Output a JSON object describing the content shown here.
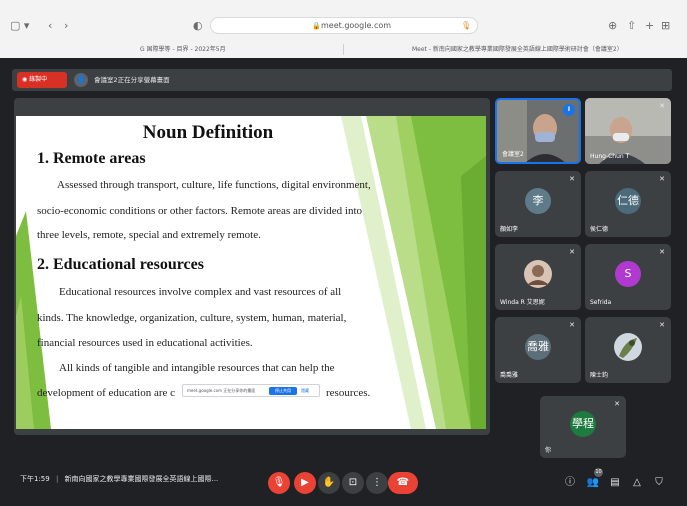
{
  "browser": {
    "url": "meet.google.com",
    "tabs": [
      "G 国際學等 - 目界 - 2022年5月",
      "Meet - 新南向國家之教學專業國際發展全英語線上國際學術研討會（會議室2）"
    ]
  },
  "banner": {
    "recording_label": "錄製中",
    "presenting_label": "會議室2正在分享螢幕畫面"
  },
  "slide": {
    "title": "Noun Definition",
    "section1_heading": "1. Remote areas",
    "section1_lines": [
      "Assessed through transport, culture, life functions, digital environment,",
      "socio-economic conditions or other factors. Remote areas are divided into",
      "three levels, remote, special and extremely remote."
    ],
    "section2_heading": "2. Educational resources",
    "section2_lines": [
      "Educational resources involve complex and vast resources of all",
      "kinds. The knowledge, organization, culture, system, human, material,",
      "financial resources used in educational activities.",
      "All kinds of tangible and intangible resources that can help the"
    ],
    "last_line_start": "development of education are c",
    "last_line_end": "resources."
  },
  "share_popup": {
    "text": "meet.google.com 正在分享你的畫面",
    "stop_label": "停止共用",
    "hide_label": "隱藏"
  },
  "participants": [
    {
      "name": "會議室2",
      "video": true
    },
    {
      "name": "Hung-Chun T",
      "video": true
    },
    {
      "name": "顏如李",
      "initial": "李",
      "color": "#5f7b8a"
    },
    {
      "name": "侯仁德",
      "initial": "仁德",
      "color": "#4b6a7a"
    },
    {
      "name": "Winda R 艾思妮",
      "photo": true
    },
    {
      "name": "Sefrida",
      "initial": "S",
      "color": "#b03ad0"
    },
    {
      "name": "喬喬雅",
      "initial": "喬雅",
      "color": "#5c6e78"
    },
    {
      "name": "陳士鈞",
      "photo": true
    },
    {
      "name": "你",
      "initial": "學程",
      "color": "#1e7a3e"
    }
  ],
  "bottom_bar": {
    "time": "下午1:59",
    "separator": "|",
    "meeting_title": "新南向國家之教學專業國際發展全英語線上國際...",
    "participant_count": "10"
  }
}
